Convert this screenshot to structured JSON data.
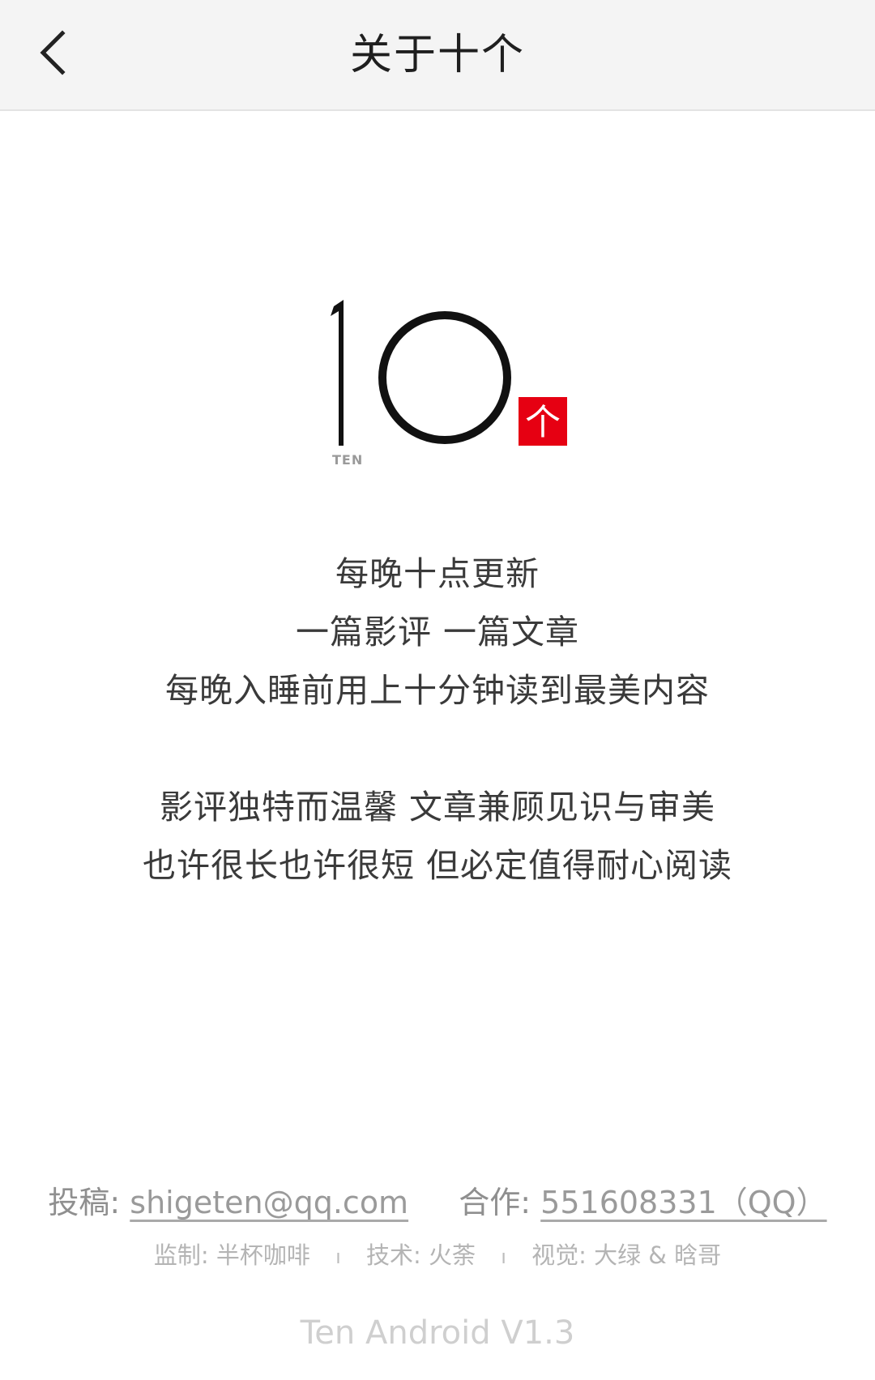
{
  "header": {
    "back_icon": "chevron-left-icon",
    "title": "关于十个"
  },
  "logo": {
    "number": "10",
    "subtitle": "TEN",
    "badge": "个",
    "badge_color": "#e60012"
  },
  "description": {
    "block1": [
      "每晚十点更新",
      "一篇影评 一篇文章",
      "每晚入睡前用上十分钟读到最美内容"
    ],
    "block2": [
      "影评独特而温馨 文章兼顾见识与审美",
      "也许很长也许很短 但必定值得耐心阅读"
    ]
  },
  "contact": {
    "submit_label": "投稿:",
    "submit_email": "shigeten@qq.com",
    "coop_label": "合作:",
    "coop_value": "551608331（QQ）"
  },
  "credits": {
    "supervise": "监制: 半杯咖啡",
    "tech": "技术: 火荼",
    "visual": "视觉: 大绿 & 晗哥",
    "separator": "ı"
  },
  "version": "Ten Android V1.3"
}
